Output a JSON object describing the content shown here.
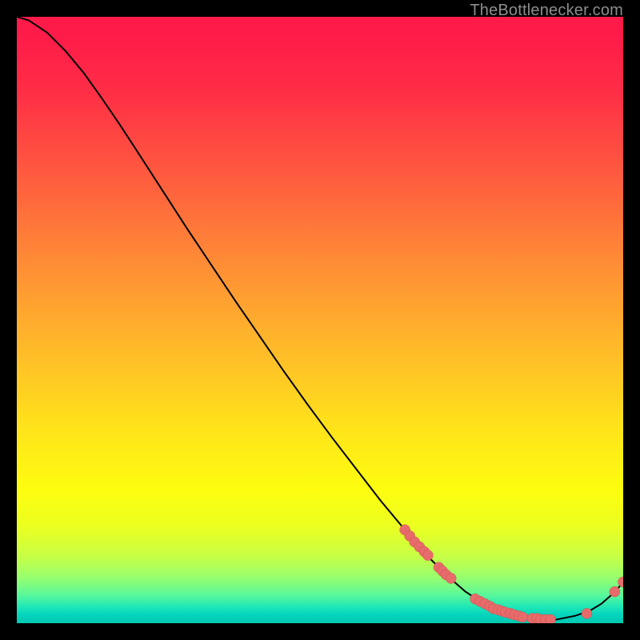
{
  "watermark": "TheBottlenecker.com",
  "colors": {
    "curve": "#000000",
    "marker": "#e86b6b",
    "marker_stroke": "#c94f4f",
    "background": "#000000"
  },
  "chart_data": {
    "type": "line",
    "title": "",
    "xlabel": "",
    "ylabel": "",
    "xlim": [
      0,
      5
    ],
    "ylim": [
      0,
      5
    ],
    "grid": false,
    "legend": false,
    "series": [
      {
        "name": "curve",
        "x": [
          0.0,
          0.1,
          0.25,
          0.4,
          0.55,
          0.7,
          0.85,
          1.0,
          1.2,
          1.4,
          1.6,
          1.8,
          2.0,
          2.2,
          2.4,
          2.6,
          2.8,
          3.0,
          3.2,
          3.4,
          3.55,
          3.7,
          3.85,
          4.0,
          4.15,
          4.3,
          4.45,
          4.6,
          4.72,
          4.82,
          4.9,
          4.95,
          5.0
        ],
        "y": [
          5.0,
          4.97,
          4.87,
          4.72,
          4.54,
          4.33,
          4.11,
          3.88,
          3.57,
          3.26,
          2.96,
          2.66,
          2.37,
          2.08,
          1.8,
          1.53,
          1.27,
          1.01,
          0.77,
          0.54,
          0.39,
          0.26,
          0.16,
          0.09,
          0.05,
          0.03,
          0.03,
          0.06,
          0.1,
          0.16,
          0.23,
          0.28,
          0.34
        ]
      }
    ],
    "scatter_points": {
      "name": "markers",
      "x": [
        3.2,
        3.24,
        3.28,
        3.32,
        3.36,
        3.39,
        3.48,
        3.51,
        3.54,
        3.58,
        3.78,
        3.82,
        3.86,
        3.9,
        3.93,
        3.97,
        4.0,
        4.03,
        4.07,
        4.1,
        4.14,
        4.17,
        4.25,
        4.29,
        4.32,
        4.36,
        4.4,
        4.7,
        4.93,
        5.0
      ],
      "y": [
        0.77,
        0.72,
        0.67,
        0.63,
        0.59,
        0.56,
        0.46,
        0.43,
        0.4,
        0.37,
        0.2,
        0.18,
        0.16,
        0.14,
        0.12,
        0.11,
        0.1,
        0.09,
        0.08,
        0.07,
        0.06,
        0.05,
        0.04,
        0.04,
        0.03,
        0.03,
        0.03,
        0.08,
        0.26,
        0.34
      ]
    }
  }
}
